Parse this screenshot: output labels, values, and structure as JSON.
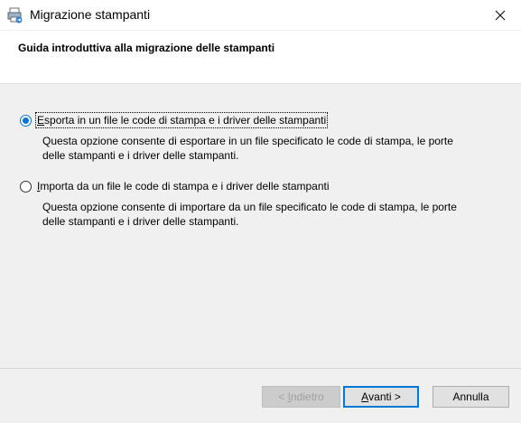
{
  "window": {
    "title": "Migrazione stampanti",
    "icon": "printer-migration-icon",
    "close_icon": "close-icon"
  },
  "header": {
    "title": "Guida introduttiva alla migrazione delle stampanti"
  },
  "options": [
    {
      "label_hotkey": "E",
      "label_rest": "sporta in un file le code di stampa e i driver delle stampanti",
      "description": "Questa opzione consente di esportare in un file specificato le code di stampa, le porte delle stampanti e i driver delle stampanti.",
      "selected": true
    },
    {
      "label_hotkey": "I",
      "label_rest": "mporta da un file le code di stampa e i driver delle stampanti",
      "description": "Questa opzione consente di importare da un file specificato le code di stampa, le porte delle stampanti e i driver delle stampanti.",
      "selected": false
    }
  ],
  "buttons": {
    "back_prefix": "< ",
    "back_hotkey": "I",
    "back_rest": "ndietro",
    "next_hotkey": "A",
    "next_rest": "vanti >",
    "cancel": "Annulla"
  },
  "colors": {
    "accent": "#0078d7",
    "panel": "#f0f0f0"
  }
}
